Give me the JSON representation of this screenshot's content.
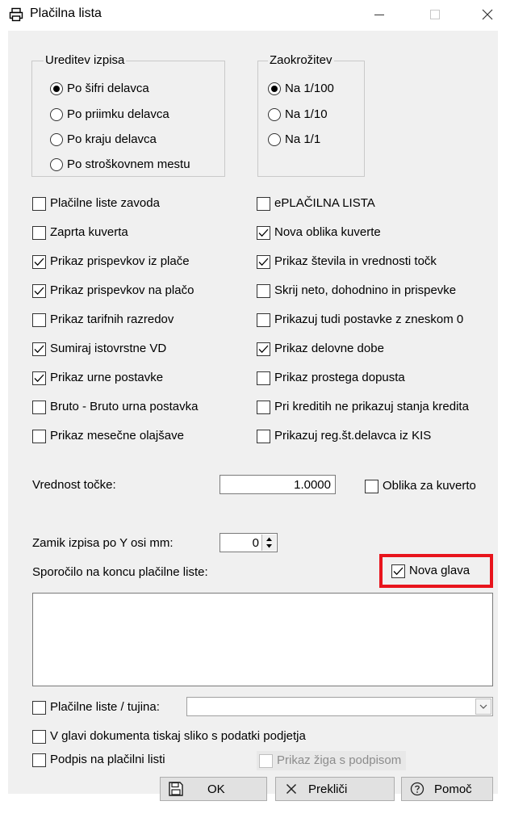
{
  "window": {
    "title": "Plačilna lista",
    "controls": {
      "minimize": "—",
      "maximize": "☐",
      "close": "✕"
    }
  },
  "sort": {
    "legend": "Ureditev izpisa",
    "options": [
      {
        "label": "Po šifri delavca",
        "selected": true
      },
      {
        "label": "Po priimku delavca",
        "selected": false
      },
      {
        "label": "Po kraju delavca",
        "selected": false
      },
      {
        "label": "Po stroškovnem mestu",
        "selected": false
      }
    ]
  },
  "rounding": {
    "legend": "Zaokrožitev",
    "options": [
      {
        "label": "Na 1/100",
        "selected": true
      },
      {
        "label": "Na 1/10",
        "selected": false
      },
      {
        "label": "Na 1/1",
        "selected": false
      }
    ]
  },
  "left_checks": [
    {
      "label": "Plačilne liste zavoda",
      "checked": false
    },
    {
      "label": "Zaprta kuverta",
      "checked": false
    },
    {
      "label": "Prikaz prispevkov iz plače",
      "checked": true
    },
    {
      "label": "Prikaz prispevkov na plačo",
      "checked": true
    },
    {
      "label": "Prikaz tarifnih razredov",
      "checked": false
    },
    {
      "label": "Sumiraj istovrstne VD",
      "checked": true
    },
    {
      "label": "Prikaz urne postavke",
      "checked": true
    },
    {
      "label": "Bruto - Bruto urna postavka",
      "checked": false
    },
    {
      "label": "Prikaz mesečne olajšave",
      "checked": false
    }
  ],
  "right_checks": [
    {
      "label": "ePLAČILNA LISTA",
      "checked": false
    },
    {
      "label": "Nova oblika kuverte",
      "checked": true
    },
    {
      "label": "Prikaz števila in vrednosti točk",
      "checked": true
    },
    {
      "label": "Skrij neto, dohodnino in prispevke",
      "checked": false
    },
    {
      "label": "Prikazuj tudi postavke z zneskom 0",
      "checked": false
    },
    {
      "label": "Prikaz delovne dobe",
      "checked": true
    },
    {
      "label": "Prikaz prostega dopusta",
      "checked": false
    },
    {
      "label": "Pri kreditih ne prikazuj stanja kredita",
      "checked": false
    },
    {
      "label": "Prikazuj reg.št.delavca iz KIS",
      "checked": false
    }
  ],
  "point_value": {
    "label": "Vrednost točke:",
    "value": "1.0000"
  },
  "envelope_form": {
    "label": "Oblika za kuverto",
    "checked": false
  },
  "offset": {
    "label": "Zamik izpisa po Y osi mm:",
    "value": "0"
  },
  "message": {
    "label": "Sporočilo na koncu plačilne liste:",
    "value": ""
  },
  "new_header": {
    "label": "Nova glava",
    "checked": true,
    "highlight_color": "#e8141c"
  },
  "foreign": {
    "label": "Plačilne liste / tujina:",
    "checked": false,
    "selected": ""
  },
  "company_image": {
    "label": "V glavi dokumenta tiskaj sliko s podatki podjetja",
    "checked": false
  },
  "signature": {
    "label": "Podpis na plačilni listi",
    "checked": false
  },
  "stamp": {
    "label": "Prikaz žiga s podpisom",
    "checked": false,
    "enabled": false
  },
  "buttons": {
    "ok": "OK",
    "cancel": "Prekliči",
    "help": "Pomoč"
  }
}
